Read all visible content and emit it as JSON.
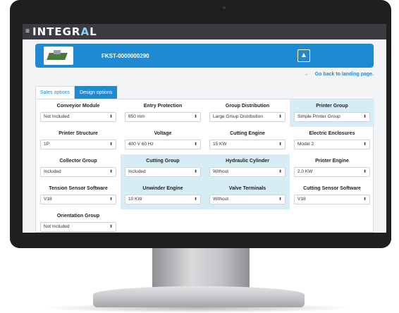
{
  "app": {
    "logo": "INTEGRAL",
    "logo_parts": [
      "INTEGR",
      "A",
      "L"
    ]
  },
  "product": {
    "code": "FKST-0000000290"
  },
  "back_link": "Go back to landing page.",
  "tabs": [
    {
      "label": "Sales options",
      "active": false
    },
    {
      "label": "Design options",
      "active": true
    }
  ],
  "options": [
    {
      "label": "Conveyior Module",
      "value": "Not Included",
      "highlighted": false
    },
    {
      "label": "Entry Protection",
      "value": "650 mm",
      "highlighted": false
    },
    {
      "label": "Group Distribution",
      "value": "Large Group Distribution",
      "highlighted": false
    },
    {
      "label": "Printer Group",
      "value": "Simple Printer Group",
      "highlighted": true
    },
    {
      "label": "Printer Structure",
      "value": "1P",
      "highlighted": false
    },
    {
      "label": "Voltage",
      "value": "400 V 60 Hz",
      "highlighted": false
    },
    {
      "label": "Cutting Engine",
      "value": "15 KW",
      "highlighted": false
    },
    {
      "label": "Electric Enclosures",
      "value": "Model 2",
      "highlighted": false
    },
    {
      "label": "Collector Group",
      "value": "Included",
      "highlighted": false
    },
    {
      "label": "Cutting Group",
      "value": "Included",
      "highlighted": true
    },
    {
      "label": "Hydraulic Cylinder",
      "value": "Without",
      "highlighted": true
    },
    {
      "label": "Printer Engine",
      "value": "2.0 KW",
      "highlighted": false
    },
    {
      "label": "Tension Sensor Software",
      "value": "V18",
      "highlighted": false
    },
    {
      "label": "Unwinder Engine",
      "value": "10 KW",
      "highlighted": true
    },
    {
      "label": "Valve Terminals",
      "value": "Without",
      "highlighted": true
    },
    {
      "label": "Cutting Sensor Software",
      "value": "V18",
      "highlighted": false
    },
    {
      "label": "Orientation Group",
      "value": "Not Included",
      "highlighted": false
    }
  ],
  "colors": {
    "primary": "#1f8ad2",
    "highlight": "#d7edf6",
    "topbar": "#3a3c41"
  }
}
